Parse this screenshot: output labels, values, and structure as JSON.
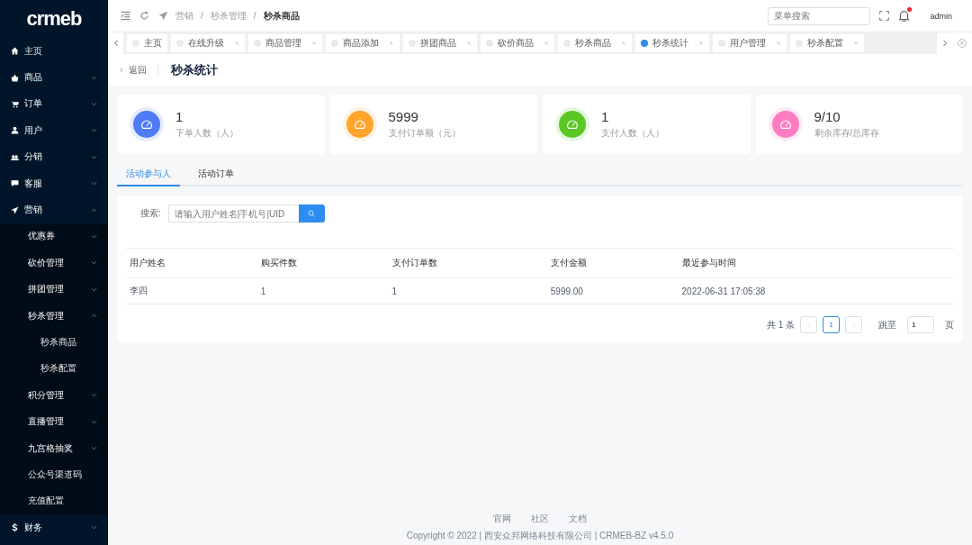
{
  "sidebar": {
    "logo": "crmeb",
    "items": [
      {
        "label": "主页",
        "kind": "link"
      },
      {
        "label": "商品",
        "kind": "submenu",
        "expanded": false
      },
      {
        "label": "订单",
        "kind": "submenu",
        "expanded": false
      },
      {
        "label": "用户",
        "kind": "submenu",
        "expanded": false
      },
      {
        "label": "分销",
        "kind": "submenu",
        "expanded": false
      },
      {
        "label": "客服",
        "kind": "submenu",
        "expanded": false
      },
      {
        "label": "营销",
        "kind": "submenu",
        "expanded": true,
        "children": [
          {
            "label": "优惠券",
            "kind": "submenu",
            "expanded": false
          },
          {
            "label": "砍价管理",
            "kind": "submenu",
            "expanded": false
          },
          {
            "label": "拼团管理",
            "kind": "submenu",
            "expanded": false
          },
          {
            "label": "秒杀管理",
            "kind": "submenu",
            "expanded": true,
            "children": [
              {
                "label": "秒杀商品",
                "kind": "link"
              },
              {
                "label": "秒杀配置",
                "kind": "link"
              }
            ]
          },
          {
            "label": "积分管理",
            "kind": "submenu",
            "expanded": false
          },
          {
            "label": "直播管理",
            "kind": "submenu",
            "expanded": false
          },
          {
            "label": "九宫格抽奖",
            "kind": "submenu",
            "expanded": false
          },
          {
            "label": "公众号渠道码",
            "kind": "link"
          },
          {
            "label": "充值配置",
            "kind": "link"
          }
        ]
      },
      {
        "label": "财务",
        "kind": "submenu",
        "expanded": false
      }
    ]
  },
  "header": {
    "breadcrumb": [
      "营销",
      "秒杀管理",
      "秒杀商品"
    ],
    "separator": "/",
    "search": {
      "placeholder": "菜单搜索"
    },
    "notification_dot": true,
    "user": "admin"
  },
  "page_tabs": [
    {
      "label": "主页",
      "selected": false,
      "closable": false
    },
    {
      "label": "在线升级",
      "selected": false,
      "closable": true
    },
    {
      "label": "商品管理",
      "selected": false,
      "closable": true
    },
    {
      "label": "商品添加",
      "selected": false,
      "closable": true
    },
    {
      "label": "拼团商品",
      "selected": false,
      "closable": true
    },
    {
      "label": "砍价商品",
      "selected": false,
      "closable": true
    },
    {
      "label": "秒杀商品",
      "selected": false,
      "closable": true
    },
    {
      "label": "秒杀统计",
      "selected": true,
      "closable": true
    },
    {
      "label": "用户管理",
      "selected": false,
      "closable": true
    },
    {
      "label": "秒杀配置",
      "selected": false,
      "closable": true
    }
  ],
  "page_header": {
    "back": "返回",
    "title": "秒杀统计"
  },
  "stats": [
    {
      "value": "1",
      "label": "下单人数（人）",
      "color": "#4e7cf6"
    },
    {
      "value": "5999",
      "label": "支付订单额（元）",
      "color": "#ffa52b"
    },
    {
      "value": "1",
      "label": "支付人数（人）",
      "color": "#5ac725"
    },
    {
      "value": "9/10",
      "label": "剩余库存/总库存",
      "color": "#ff7bbf"
    }
  ],
  "content_tabs": [
    {
      "label": "活动参与人",
      "selected": true
    },
    {
      "label": "活动订单",
      "selected": false
    }
  ],
  "filter": {
    "label": "搜索:",
    "placeholder": "请输入用户姓名|手机号|UID"
  },
  "table": {
    "columns": [
      "用户姓名",
      "购买件数",
      "支付订单数",
      "支付金额",
      "最近参与时间"
    ],
    "rows": [
      [
        "李四",
        "1",
        "1",
        "5999.00",
        "2022-06-31 17:05:38"
      ]
    ]
  },
  "pagination": {
    "total": "共 1 条",
    "pages": [
      {
        "label": "1",
        "selected": true
      }
    ],
    "jump_label": "跳至",
    "jump_value": "1",
    "page_unit": "页"
  },
  "footer": {
    "links": [
      "官网",
      "社区",
      "文档"
    ],
    "copyright": "Copyright © 2022 | 西安众邦网络科技有限公司 | CRMEB-BZ v4.5.0"
  }
}
